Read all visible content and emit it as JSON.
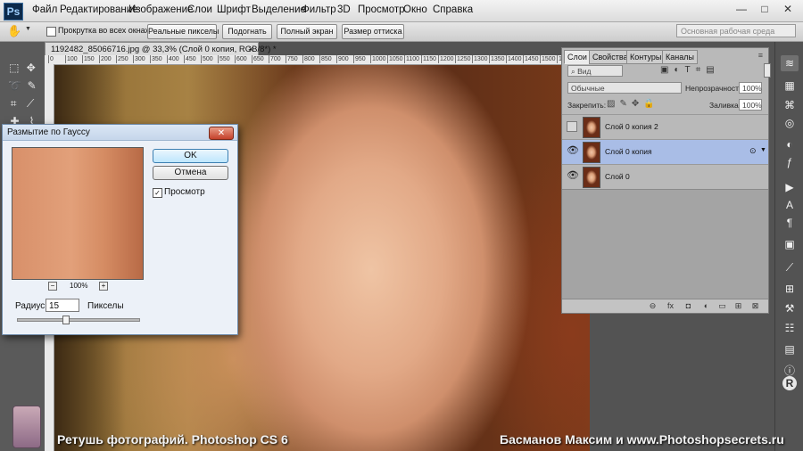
{
  "app": {
    "logo": "Ps",
    "menu": [
      "Файл",
      "Редактирование",
      "Изображение",
      "Слои",
      "Шрифт",
      "Выделение",
      "Фильтр",
      "3D",
      "Просмотр",
      "Окно",
      "Справка"
    ],
    "window_controls": [
      "—",
      "□",
      "✕"
    ]
  },
  "options_bar": {
    "scroll_all_label": "Прокрутка во всех окнах",
    "buttons": [
      "Реальные пикселы",
      "Подогнать",
      "Полный экран",
      "Размер оттиска"
    ],
    "workspace": "Основная рабочая среда"
  },
  "document": {
    "tab_title": "1192482_85066716.jpg @ 33,3% (Слой 0 копия, RGB/8*) *",
    "ruler_ticks": [
      "0",
      "100",
      "150",
      "200",
      "250",
      "300",
      "350",
      "400",
      "450",
      "500",
      "550",
      "600",
      "650",
      "700",
      "750",
      "800",
      "850",
      "900",
      "950",
      "1000",
      "1050",
      "1100",
      "1150",
      "1200",
      "1250",
      "1300",
      "1350",
      "1400",
      "1450",
      "1500",
      "1550"
    ]
  },
  "layers_panel": {
    "tabs": [
      "Слои",
      "Свойства",
      "Контуры",
      "Каналы"
    ],
    "filter_kind": "Вид",
    "blend_mode": "Обычные",
    "opacity_label": "Непрозрачность:",
    "opacity_value": "100%",
    "lock_label": "Закрепить:",
    "fill_label": "Заливка:",
    "fill_value": "100%",
    "layers": [
      {
        "name": "Слой 0 копия 2",
        "visible": false,
        "selected": false
      },
      {
        "name": "Слой 0 копия",
        "visible": true,
        "selected": true
      },
      {
        "name": "Слой 0",
        "visible": true,
        "selected": false
      }
    ],
    "bottom_icons": [
      "link-icon",
      "fx-icon",
      "mask-icon",
      "adjustment-icon",
      "group-icon",
      "new-layer-icon",
      "trash-icon"
    ],
    "bottom_glyphs": [
      "⊖",
      "fx",
      "◘",
      "◐",
      "▭",
      "⊞",
      "⊠"
    ]
  },
  "dialog": {
    "title": "Размытие по Гауссу",
    "close_glyph": "✕",
    "ok_label": "OK",
    "cancel_label": "Отмена",
    "preview_label": "Просмотр",
    "preview_checked": true,
    "zoom_out": "−",
    "zoom_level": "100%",
    "zoom_in": "+",
    "radius_label": "Радиус:",
    "radius_value": "15",
    "radius_unit": "Пикселы",
    "slider_value_fraction": 0.4
  },
  "captions": {
    "left": "Ретушь фотографий. Photoshop CS 6",
    "right": "Басманов Максим и www.Photoshopsecrets.ru"
  },
  "colors": {
    "selected_layer": "#a9bde6",
    "ok_border": "#3c7fb1"
  }
}
